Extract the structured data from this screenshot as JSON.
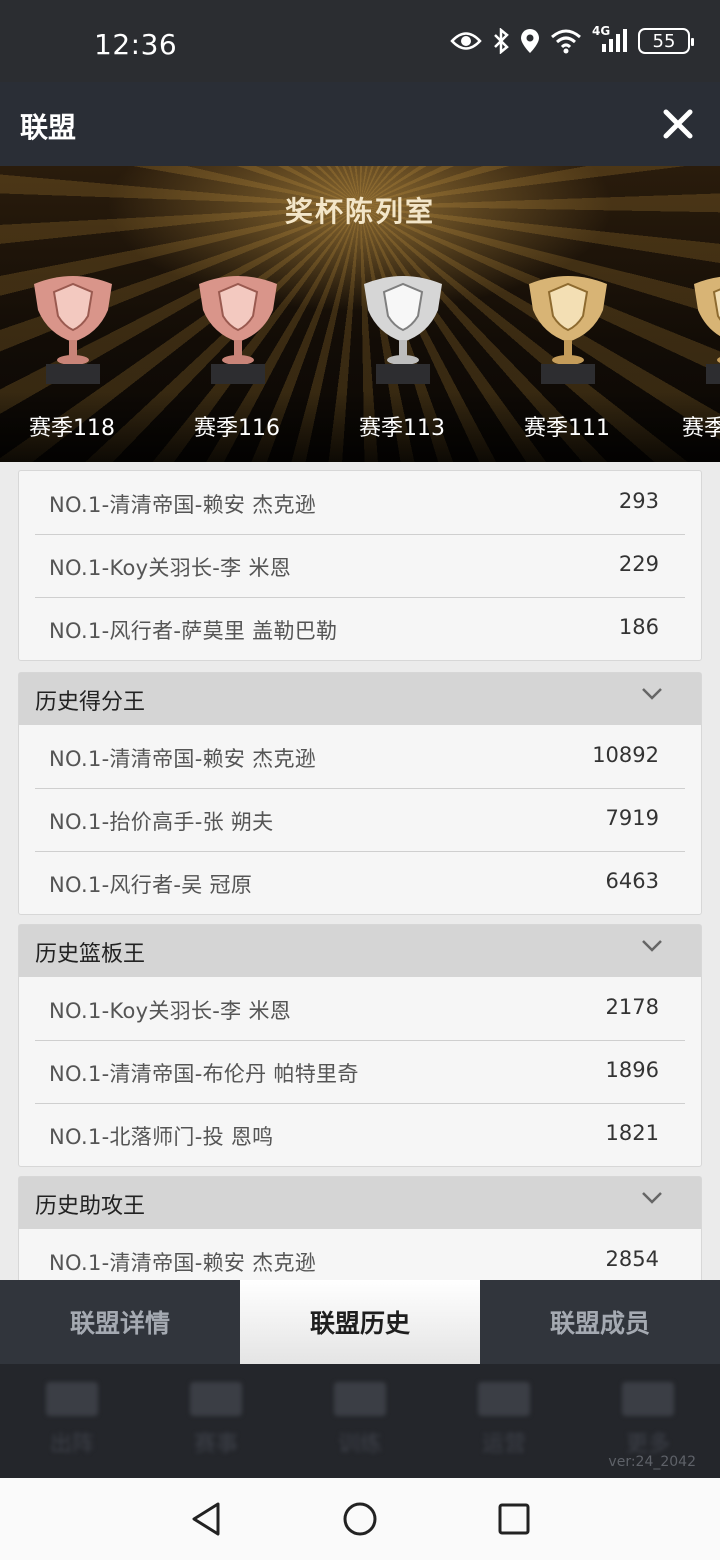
{
  "status_bar": {
    "time": "12:36",
    "network": "4G",
    "battery": "55",
    "icons": [
      "eye-icon",
      "bluetooth-icon",
      "location-icon",
      "wifi-icon",
      "signal-icon",
      "battery-icon"
    ]
  },
  "header": {
    "title": "联盟",
    "close_icon": "close-icon"
  },
  "banner": {
    "title": "奖杯陈列室",
    "trophies": [
      {
        "label": "赛季118",
        "color": "#d9958a"
      },
      {
        "label": "赛季116",
        "color": "#d9958a"
      },
      {
        "label": "赛季113",
        "color": "#d6d6d6"
      },
      {
        "label": "赛季111",
        "color": "#d8b475"
      },
      {
        "label": "赛季",
        "color": "#d8b475"
      }
    ]
  },
  "sections": [
    {
      "title": "",
      "rows": [
        {
          "name": "NO.1-清清帝国-赖安 杰克逊",
          "value": "293"
        },
        {
          "name": "NO.1-Koy关羽长-李 米恩",
          "value": "229"
        },
        {
          "name": "NO.1-风行者-萨莫里 盖勒巴勒",
          "value": "186"
        }
      ]
    },
    {
      "title": "历史得分王",
      "rows": [
        {
          "name": "NO.1-清清帝国-赖安 杰克逊",
          "value": "10892"
        },
        {
          "name": "NO.1-抬价高手-张 朔夫",
          "value": "7919"
        },
        {
          "name": "NO.1-风行者-吴 冠原",
          "value": "6463"
        }
      ]
    },
    {
      "title": "历史篮板王",
      "rows": [
        {
          "name": "NO.1-Koy关羽长-李 米恩",
          "value": "2178"
        },
        {
          "name": "NO.1-清清帝国-布伦丹 帕特里奇",
          "value": "1896"
        },
        {
          "name": "NO.1-北落师门-投 恩鸣",
          "value": "1821"
        }
      ]
    },
    {
      "title": "历史助攻王",
      "rows": [
        {
          "name": "NO.1-清清帝国-赖安 杰克逊",
          "value": "2854"
        }
      ]
    }
  ],
  "tabs": [
    {
      "label": "联盟详情",
      "active": false
    },
    {
      "label": "联盟历史",
      "active": true
    },
    {
      "label": "联盟成员",
      "active": false
    }
  ],
  "under_nav": {
    "items": [
      "出阵",
      "赛事",
      "训练",
      "运营",
      "更多"
    ],
    "version": "ver:24_2042"
  },
  "system_nav": [
    "back-icon",
    "home-icon",
    "recents-icon"
  ]
}
